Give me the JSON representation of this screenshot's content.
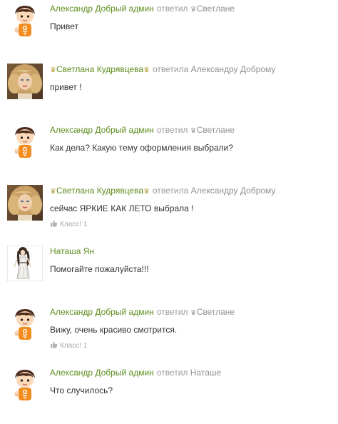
{
  "comments": [
    {
      "avatar": "odnoklassniki-boy-avatar",
      "author": "Александр Добрый админ",
      "author_crowned": false,
      "verb": "ответил",
      "target": "Светлане",
      "target_crowned": true,
      "text": "Привет",
      "likes": ""
    },
    {
      "avatar": "woman-photo-avatar",
      "author": "Светлана Кудрявцева",
      "author_crowned": true,
      "verb": "ответила",
      "target": "Александру Доброму",
      "target_crowned": false,
      "text": "привет !",
      "likes": ""
    },
    {
      "avatar": "odnoklassniki-boy-avatar",
      "author": "Александр Добрый админ",
      "author_crowned": false,
      "verb": "ответил",
      "target": "Светлане",
      "target_crowned": true,
      "text": "Как дела? Какую тему оформления выбрали?",
      "likes": ""
    },
    {
      "avatar": "woman-photo-avatar",
      "author": "Светлана Кудрявцева",
      "author_crowned": true,
      "verb": "ответила",
      "target": "Александру Доброму",
      "target_crowned": false,
      "text": "сейчас ЯРКИЕ КАК ЛЕТО выбрала !",
      "likes": "Класс! 1"
    },
    {
      "avatar": "fashion-sketch-avatar",
      "author": "Наташа Ян",
      "author_crowned": false,
      "verb": "",
      "target": "",
      "target_crowned": false,
      "text": "Помогайте пожалуйста!!!",
      "likes": ""
    },
    {
      "avatar": "odnoklassniki-boy-avatar",
      "author": "Александр Добрый админ",
      "author_crowned": false,
      "verb": "ответил",
      "target": "Светлане",
      "target_crowned": true,
      "text": "Вижу, очень красиво смотрится.",
      "likes": "Класс! 1"
    },
    {
      "avatar": "odnoklassniki-boy-avatar",
      "author": "Александр Добрый админ",
      "author_crowned": false,
      "verb": "ответил",
      "target": "Наташе",
      "target_crowned": false,
      "text": "Что случилось?",
      "likes": ""
    }
  ],
  "colors": {
    "author": "#5e8e1f",
    "meta": "#9a9a9a",
    "text": "#333333",
    "ok_orange": "#f28c1f"
  },
  "crown_glyph": "♛"
}
